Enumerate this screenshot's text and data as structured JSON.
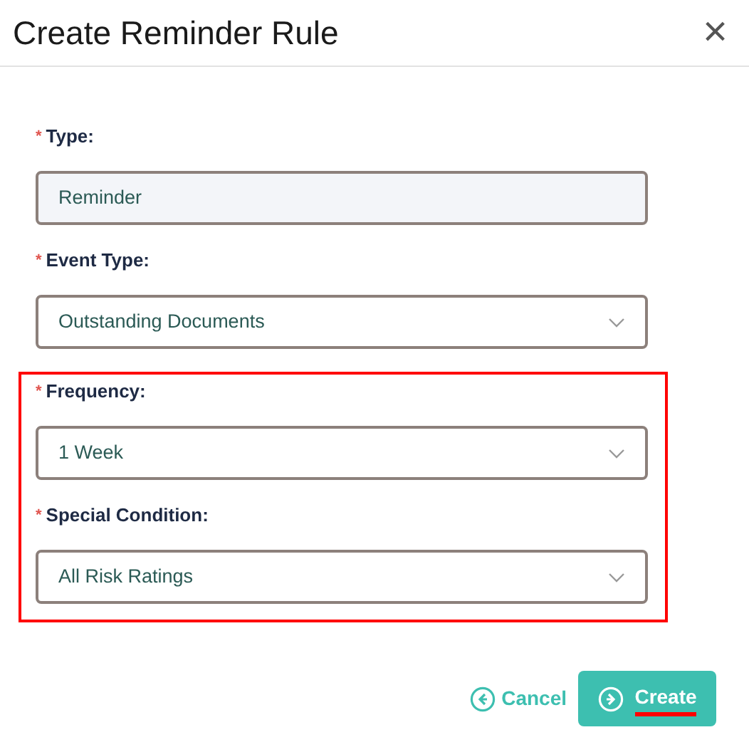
{
  "dialog": {
    "title": "Create Reminder Rule",
    "close": "×"
  },
  "fields": [
    {
      "label": "Type:",
      "required_mark": "*",
      "kind": "readonly",
      "value": "Reminder",
      "highlighted": false
    },
    {
      "label": "Event Type:",
      "required_mark": "*",
      "kind": "select",
      "value": "Outstanding Documents",
      "highlighted": false
    },
    {
      "label": "Frequency:",
      "required_mark": "*",
      "kind": "select",
      "value": "1 Week",
      "highlighted": true
    },
    {
      "label": "Special Condition:",
      "required_mark": "*",
      "kind": "select",
      "value": "All Risk Ratings",
      "highlighted": true
    }
  ],
  "buttons": [
    {
      "label": "Cancel",
      "kind": "link",
      "underlined": false
    },
    {
      "label": "Create",
      "kind": "primary",
      "underlined": true
    }
  ]
}
